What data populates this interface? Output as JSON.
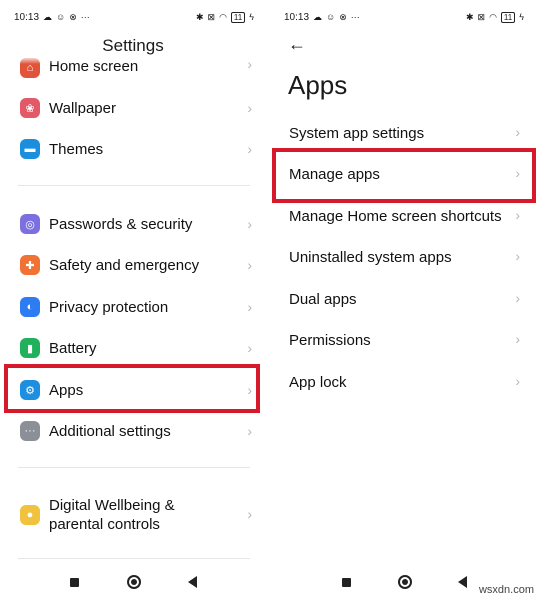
{
  "status_bar": {
    "time": "10:13",
    "battery": "11"
  },
  "left": {
    "title": "Settings",
    "items": [
      {
        "label": "Home screen",
        "icon": "home-screen-icon",
        "color": "#e1543a"
      },
      {
        "label": "Wallpaper",
        "icon": "wallpaper-icon",
        "color": "#e25a68"
      },
      {
        "label": "Themes",
        "icon": "themes-icon",
        "color": "#1b8ede"
      },
      {
        "label": "Passwords & security",
        "icon": "fingerprint-icon",
        "color": "#7c6fe0"
      },
      {
        "label": "Safety and emergency",
        "icon": "emergency-icon",
        "color": "#f07335"
      },
      {
        "label": "Privacy protection",
        "icon": "privacy-icon",
        "color": "#2d7cf2"
      },
      {
        "label": "Battery",
        "icon": "battery-icon",
        "color": "#21b15c"
      },
      {
        "label": "Apps",
        "icon": "apps-gear-icon",
        "color": "#1e8fe0"
      },
      {
        "label": "Additional settings",
        "icon": "additional-settings-icon",
        "color": "#8a8f98"
      },
      {
        "label": "Digital Wellbeing &",
        "label2": "parental controls",
        "icon": "wellbeing-icon",
        "color": "#f0c23d"
      }
    ]
  },
  "right": {
    "title": "Apps",
    "items": [
      {
        "label": "System app settings"
      },
      {
        "label": "Manage apps"
      },
      {
        "label": "Manage Home screen shortcuts"
      },
      {
        "label": "Uninstalled system apps"
      },
      {
        "label": "Dual apps"
      },
      {
        "label": "Permissions"
      },
      {
        "label": "App lock"
      }
    ]
  },
  "highlight_color": "#d6192b",
  "watermark": "wsxdn.com"
}
